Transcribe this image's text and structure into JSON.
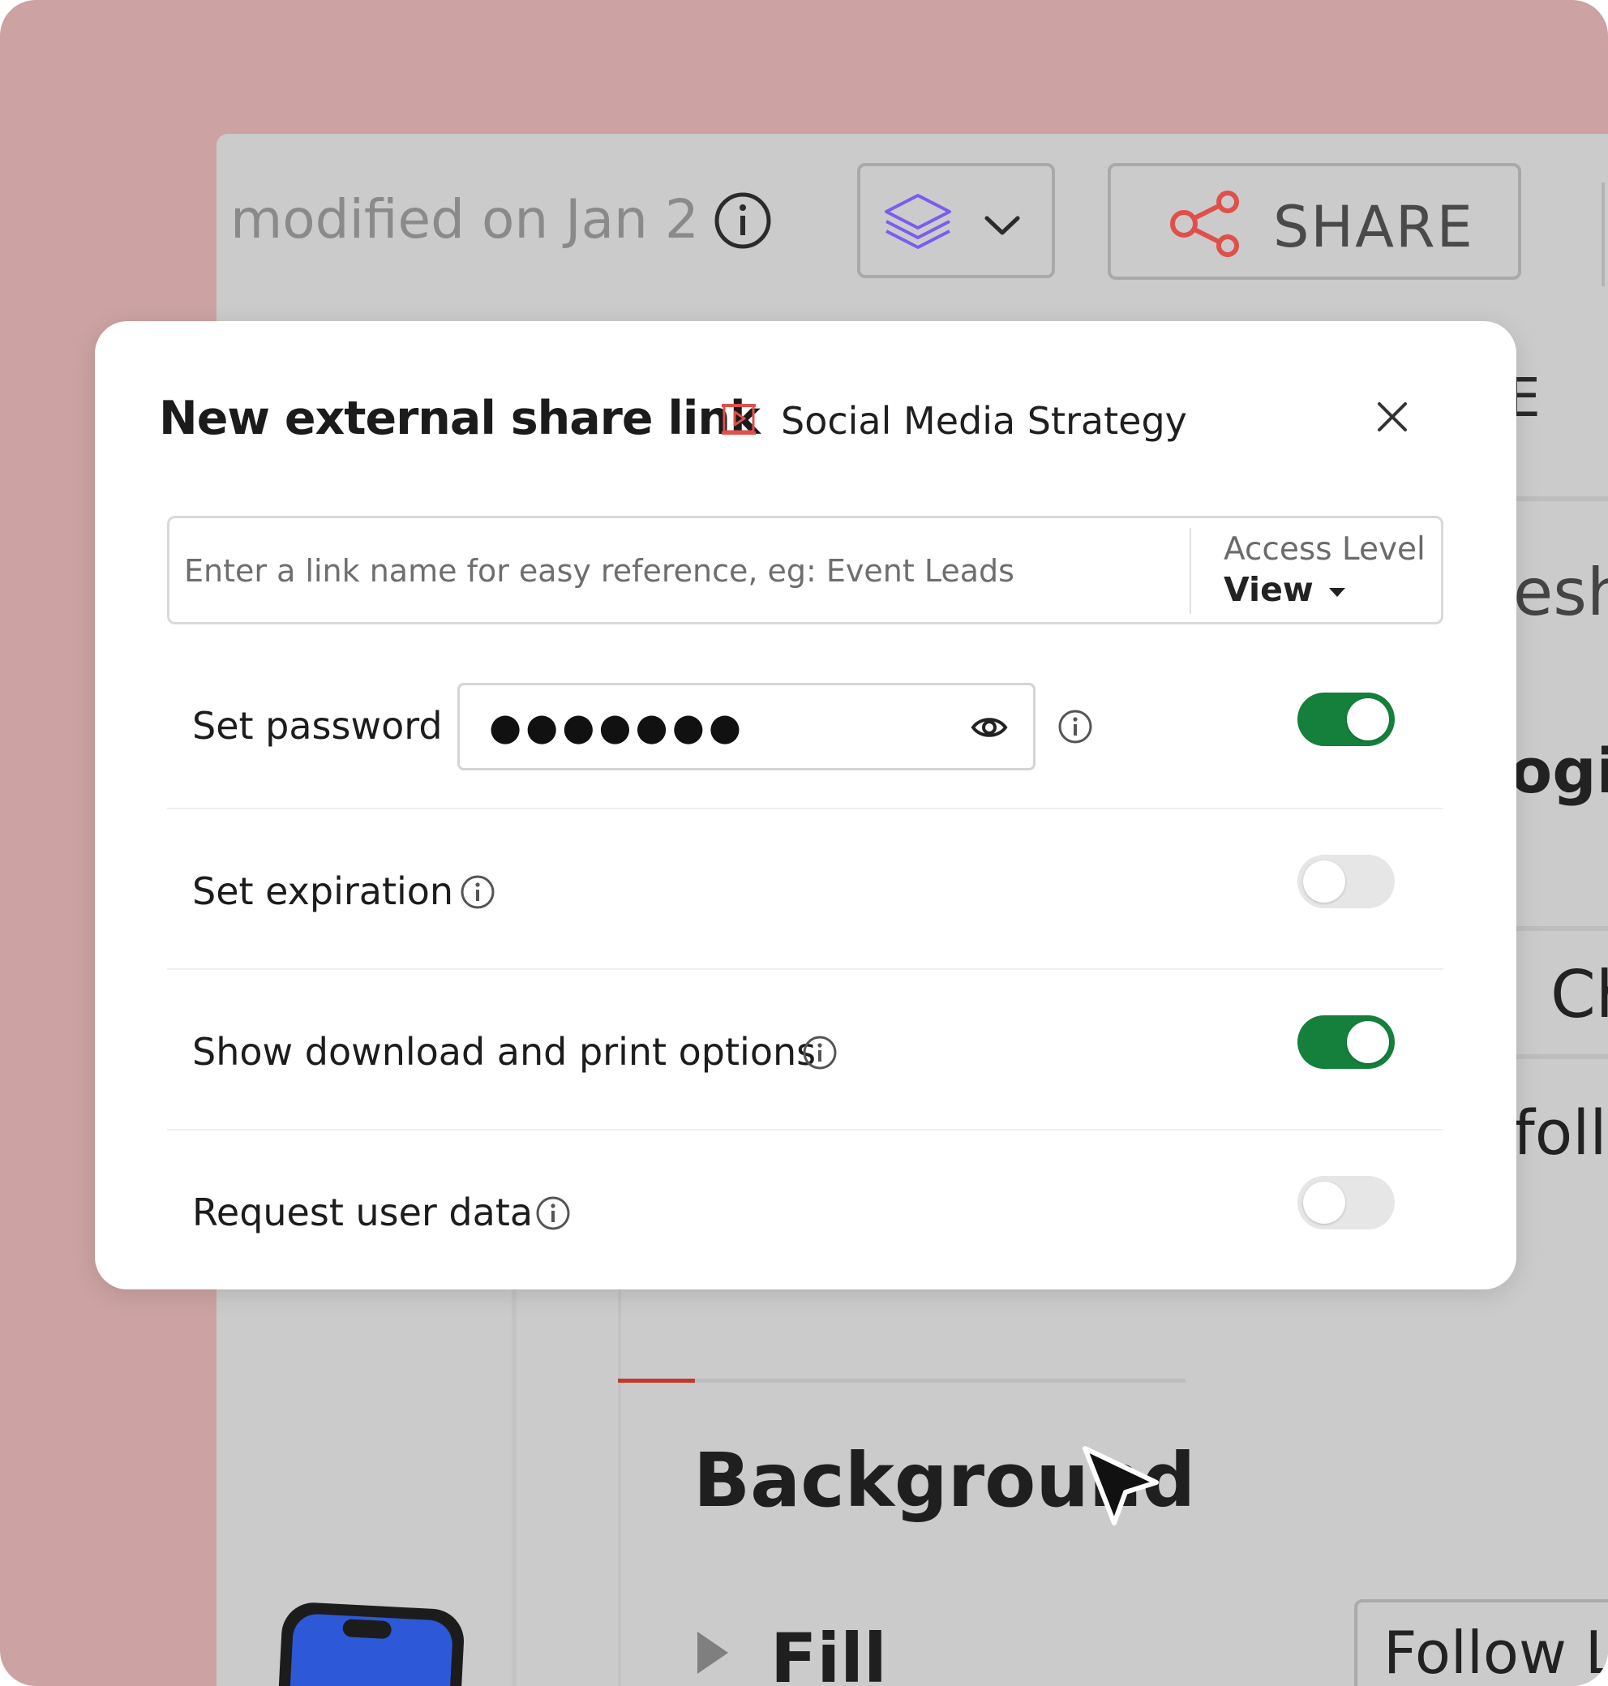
{
  "topbar": {
    "modified_text": "modified on Jan 2",
    "share_label": "SHARE"
  },
  "background": {
    "partial_e": "E",
    "partial_esh": "esh",
    "partial_logi": "ogi",
    "partial_ch": "Ch",
    "partial_foll": "foll",
    "section_title": "Background",
    "fill_label": "Fill",
    "follow_label": "Follow L"
  },
  "modal": {
    "title": "New external share link",
    "doc_name": "Social Media Strategy",
    "link_name_placeholder": "Enter a link name for easy reference, eg: Event Leads",
    "link_name_value": "",
    "access_level_label": "Access Level",
    "access_level_value": "View",
    "rows": [
      {
        "label": "Set password",
        "enabled": true
      },
      {
        "label": "Set expiration",
        "enabled": false
      },
      {
        "label": "Show download and print options",
        "enabled": true
      },
      {
        "label": "Request user data",
        "enabled": false
      }
    ],
    "password_mask": "●●●●●●●"
  },
  "colors": {
    "backdrop": "#cca3a2",
    "toggle_on": "#14803c",
    "toggle_off": "#e6e6e6",
    "share_icon": "#e0504a",
    "layers_icon": "#7a5cf0",
    "doc_icon": "#e0504a"
  },
  "icons": [
    "info-icon",
    "layers-icon",
    "chevron-down-icon",
    "share-icon",
    "presentation-icon",
    "close-icon",
    "eye-icon",
    "caret-down-icon",
    "cursor-icon"
  ]
}
